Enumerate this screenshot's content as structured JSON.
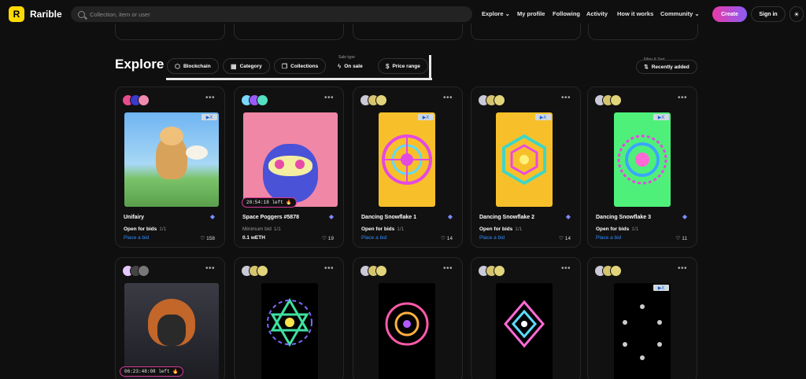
{
  "app": {
    "logo_letter": "R",
    "name": "Rarible"
  },
  "search": {
    "placeholder": "Collection, item or user"
  },
  "nav": {
    "explore": "Explore",
    "my_profile": "My profile",
    "following": "Following",
    "activity": "Activity",
    "how_it_works": "How it works",
    "community": "Community"
  },
  "header_buttons": {
    "create": "Create",
    "sign_in": "Sign in"
  },
  "explore": {
    "title": "Explore",
    "filters": {
      "blockchain": "Blockchain",
      "category": "Category",
      "collections": "Collections",
      "sale_type_label": "Sale type",
      "on_sale": "On sale",
      "price_range": "Price range"
    },
    "filter_sort_label": "Filter & Sort",
    "sort": "Recently added"
  },
  "cards": [
    {
      "name": "Unifairy",
      "status": "Open for bids",
      "edition": "1/1",
      "action": "Place a bid",
      "likes": "158"
    },
    {
      "name": "Space Poggers #5878",
      "status": "Minimum bid",
      "edition": "1/1",
      "price": "0.1 wETH",
      "likes": "19",
      "timer": "20:54:18 left 🔥"
    },
    {
      "name": "Dancing Snowflake 1",
      "status": "Open for bids",
      "edition": "1/1",
      "action": "Place a bid",
      "likes": "14"
    },
    {
      "name": "Dancing Snowflake 2",
      "status": "Open for bids",
      "edition": "1/1",
      "action": "Place a bid",
      "likes": "14"
    },
    {
      "name": "Dancing Snowflake 3",
      "status": "Open for bids",
      "edition": "1/1",
      "action": "Place a bid",
      "likes": "11"
    },
    {
      "timer": "06:23:48:08 left 🔥"
    }
  ],
  "ad_badge": "▶X",
  "colors": {
    "accent_create_start": "#ea3aa8",
    "accent_create_end": "#8b5cf6",
    "link_blue": "#2f8bff",
    "logo_yellow": "#feda03"
  }
}
